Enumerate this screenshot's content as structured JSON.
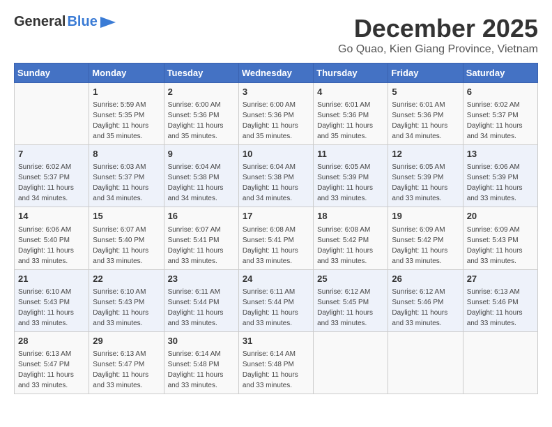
{
  "header": {
    "logo_general": "General",
    "logo_blue": "Blue",
    "month": "December 2025",
    "location": "Go Quao, Kien Giang Province, Vietnam"
  },
  "days_of_week": [
    "Sunday",
    "Monday",
    "Tuesday",
    "Wednesday",
    "Thursday",
    "Friday",
    "Saturday"
  ],
  "weeks": [
    [
      {
        "day": "",
        "sunrise": "",
        "sunset": "",
        "daylight": ""
      },
      {
        "day": "1",
        "sunrise": "Sunrise: 5:59 AM",
        "sunset": "Sunset: 5:35 PM",
        "daylight": "Daylight: 11 hours and 35 minutes."
      },
      {
        "day": "2",
        "sunrise": "Sunrise: 6:00 AM",
        "sunset": "Sunset: 5:36 PM",
        "daylight": "Daylight: 11 hours and 35 minutes."
      },
      {
        "day": "3",
        "sunrise": "Sunrise: 6:00 AM",
        "sunset": "Sunset: 5:36 PM",
        "daylight": "Daylight: 11 hours and 35 minutes."
      },
      {
        "day": "4",
        "sunrise": "Sunrise: 6:01 AM",
        "sunset": "Sunset: 5:36 PM",
        "daylight": "Daylight: 11 hours and 35 minutes."
      },
      {
        "day": "5",
        "sunrise": "Sunrise: 6:01 AM",
        "sunset": "Sunset: 5:36 PM",
        "daylight": "Daylight: 11 hours and 34 minutes."
      },
      {
        "day": "6",
        "sunrise": "Sunrise: 6:02 AM",
        "sunset": "Sunset: 5:37 PM",
        "daylight": "Daylight: 11 hours and 34 minutes."
      }
    ],
    [
      {
        "day": "7",
        "sunrise": "Sunrise: 6:02 AM",
        "sunset": "Sunset: 5:37 PM",
        "daylight": "Daylight: 11 hours and 34 minutes."
      },
      {
        "day": "8",
        "sunrise": "Sunrise: 6:03 AM",
        "sunset": "Sunset: 5:37 PM",
        "daylight": "Daylight: 11 hours and 34 minutes."
      },
      {
        "day": "9",
        "sunrise": "Sunrise: 6:04 AM",
        "sunset": "Sunset: 5:38 PM",
        "daylight": "Daylight: 11 hours and 34 minutes."
      },
      {
        "day": "10",
        "sunrise": "Sunrise: 6:04 AM",
        "sunset": "Sunset: 5:38 PM",
        "daylight": "Daylight: 11 hours and 34 minutes."
      },
      {
        "day": "11",
        "sunrise": "Sunrise: 6:05 AM",
        "sunset": "Sunset: 5:39 PM",
        "daylight": "Daylight: 11 hours and 33 minutes."
      },
      {
        "day": "12",
        "sunrise": "Sunrise: 6:05 AM",
        "sunset": "Sunset: 5:39 PM",
        "daylight": "Daylight: 11 hours and 33 minutes."
      },
      {
        "day": "13",
        "sunrise": "Sunrise: 6:06 AM",
        "sunset": "Sunset: 5:39 PM",
        "daylight": "Daylight: 11 hours and 33 minutes."
      }
    ],
    [
      {
        "day": "14",
        "sunrise": "Sunrise: 6:06 AM",
        "sunset": "Sunset: 5:40 PM",
        "daylight": "Daylight: 11 hours and 33 minutes."
      },
      {
        "day": "15",
        "sunrise": "Sunrise: 6:07 AM",
        "sunset": "Sunset: 5:40 PM",
        "daylight": "Daylight: 11 hours and 33 minutes."
      },
      {
        "day": "16",
        "sunrise": "Sunrise: 6:07 AM",
        "sunset": "Sunset: 5:41 PM",
        "daylight": "Daylight: 11 hours and 33 minutes."
      },
      {
        "day": "17",
        "sunrise": "Sunrise: 6:08 AM",
        "sunset": "Sunset: 5:41 PM",
        "daylight": "Daylight: 11 hours and 33 minutes."
      },
      {
        "day": "18",
        "sunrise": "Sunrise: 6:08 AM",
        "sunset": "Sunset: 5:42 PM",
        "daylight": "Daylight: 11 hours and 33 minutes."
      },
      {
        "day": "19",
        "sunrise": "Sunrise: 6:09 AM",
        "sunset": "Sunset: 5:42 PM",
        "daylight": "Daylight: 11 hours and 33 minutes."
      },
      {
        "day": "20",
        "sunrise": "Sunrise: 6:09 AM",
        "sunset": "Sunset: 5:43 PM",
        "daylight": "Daylight: 11 hours and 33 minutes."
      }
    ],
    [
      {
        "day": "21",
        "sunrise": "Sunrise: 6:10 AM",
        "sunset": "Sunset: 5:43 PM",
        "daylight": "Daylight: 11 hours and 33 minutes."
      },
      {
        "day": "22",
        "sunrise": "Sunrise: 6:10 AM",
        "sunset": "Sunset: 5:43 PM",
        "daylight": "Daylight: 11 hours and 33 minutes."
      },
      {
        "day": "23",
        "sunrise": "Sunrise: 6:11 AM",
        "sunset": "Sunset: 5:44 PM",
        "daylight": "Daylight: 11 hours and 33 minutes."
      },
      {
        "day": "24",
        "sunrise": "Sunrise: 6:11 AM",
        "sunset": "Sunset: 5:44 PM",
        "daylight": "Daylight: 11 hours and 33 minutes."
      },
      {
        "day": "25",
        "sunrise": "Sunrise: 6:12 AM",
        "sunset": "Sunset: 5:45 PM",
        "daylight": "Daylight: 11 hours and 33 minutes."
      },
      {
        "day": "26",
        "sunrise": "Sunrise: 6:12 AM",
        "sunset": "Sunset: 5:46 PM",
        "daylight": "Daylight: 11 hours and 33 minutes."
      },
      {
        "day": "27",
        "sunrise": "Sunrise: 6:13 AM",
        "sunset": "Sunset: 5:46 PM",
        "daylight": "Daylight: 11 hours and 33 minutes."
      }
    ],
    [
      {
        "day": "28",
        "sunrise": "Sunrise: 6:13 AM",
        "sunset": "Sunset: 5:47 PM",
        "daylight": "Daylight: 11 hours and 33 minutes."
      },
      {
        "day": "29",
        "sunrise": "Sunrise: 6:13 AM",
        "sunset": "Sunset: 5:47 PM",
        "daylight": "Daylight: 11 hours and 33 minutes."
      },
      {
        "day": "30",
        "sunrise": "Sunrise: 6:14 AM",
        "sunset": "Sunset: 5:48 PM",
        "daylight": "Daylight: 11 hours and 33 minutes."
      },
      {
        "day": "31",
        "sunrise": "Sunrise: 6:14 AM",
        "sunset": "Sunset: 5:48 PM",
        "daylight": "Daylight: 11 hours and 33 minutes."
      },
      {
        "day": "",
        "sunrise": "",
        "sunset": "",
        "daylight": ""
      },
      {
        "day": "",
        "sunrise": "",
        "sunset": "",
        "daylight": ""
      },
      {
        "day": "",
        "sunrise": "",
        "sunset": "",
        "daylight": ""
      }
    ]
  ]
}
